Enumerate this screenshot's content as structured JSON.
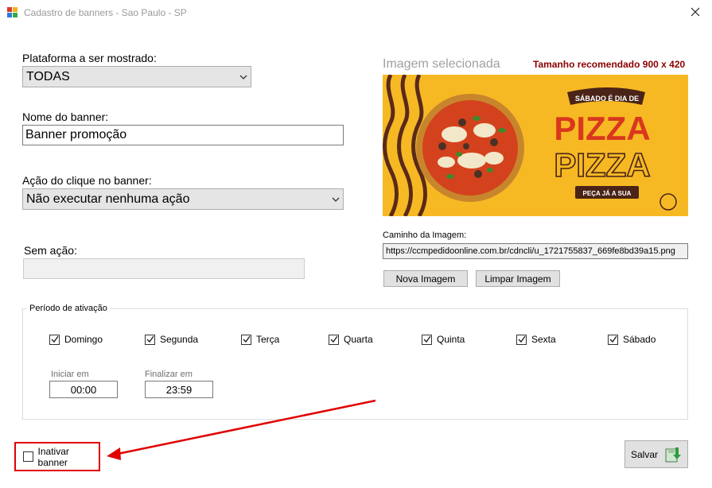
{
  "window": {
    "title": "Cadastro de banners - Sao Paulo - SP"
  },
  "form": {
    "platform_label": "Plataforma a ser mostrado:",
    "platform_value": "TODAS",
    "name_label": "Nome do banner:",
    "name_value": "Banner promoção",
    "action_label": "Ação do clique no banner:",
    "action_value": "Não executar nenhuma ação",
    "no_action_label": "Sem ação:",
    "no_action_value": ""
  },
  "image": {
    "title": "Imagem selecionada",
    "recommended": "Tamanho recomendado 900 x 420",
    "banner_top": "SÁBADO É DIA DE",
    "banner_main": "PIZZA",
    "banner_outline": "PIZZA",
    "banner_cta": "PEÇA JÁ A SUA",
    "path_label": "Caminho da Imagem:",
    "path_value": "https://ccmpedidoonline.com.br/cdncli/u_1721755837_669fe8bd39a15.png",
    "new_button": "Nova Imagem",
    "clear_button": "Limpar Imagem"
  },
  "activation": {
    "title": "Período de ativação",
    "days": [
      {
        "label": "Domingo",
        "checked": true
      },
      {
        "label": "Segunda",
        "checked": true
      },
      {
        "label": "Terça",
        "checked": true
      },
      {
        "label": "Quarta",
        "checked": true
      },
      {
        "label": "Quinta",
        "checked": true
      },
      {
        "label": "Sexta",
        "checked": true
      },
      {
        "label": "Sábado",
        "checked": true
      }
    ],
    "start_label": "Iniciar em",
    "start_value": "00:00",
    "end_label": "Finalizar em",
    "end_value": "23:59"
  },
  "footer": {
    "inactivate_label": "Inativar banner",
    "inactivate_checked": false,
    "save_label": "Salvar"
  },
  "colors": {
    "highlight": "#e00000",
    "recommend_text": "#8b0000",
    "banner_bg": "#f7b923",
    "pizza_red": "#d9371e"
  }
}
